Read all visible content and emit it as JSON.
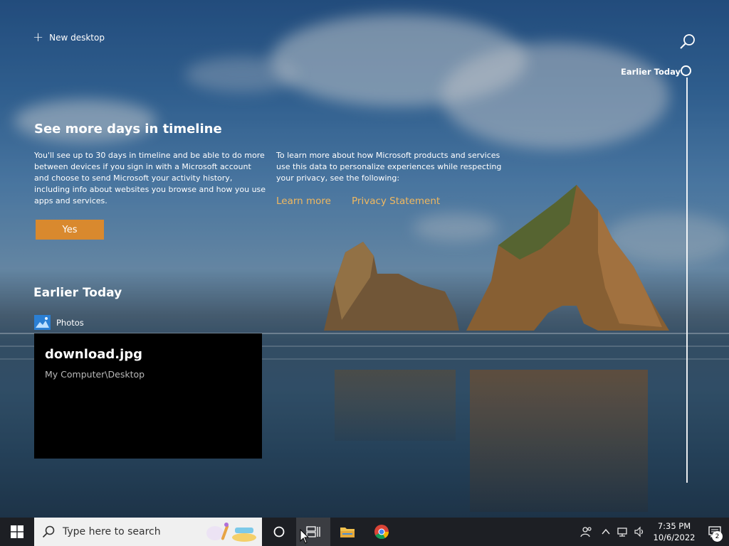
{
  "timeline": {
    "new_desktop_label": "New desktop",
    "promo": {
      "title": "See more days in timeline",
      "left_text": "You'll see up to 30 days in timeline and be able to do more between devices if you sign in with a Microsoft account and choose to send Microsoft your activity history, including info about websites you browse and how you use apps and services.",
      "right_text": "To learn more about how Microsoft products and services use this data to personalize experiences while respecting your privacy, see the following:",
      "learn_more": "Learn more",
      "privacy": "Privacy Statement",
      "yes_label": "Yes"
    },
    "section_title": "Earlier Today",
    "activity": {
      "app_name": "Photos",
      "file_name": "download.jpg",
      "file_path": "My Computer\\Desktop"
    },
    "scrubber_label": "Earlier Today"
  },
  "taskbar": {
    "search_placeholder": "Type here to search",
    "clock_time": "7:35 PM",
    "clock_date": "10/6/2022",
    "notification_count": "2",
    "pinned": [
      "cortana-icon",
      "task-view-icon",
      "file-explorer-icon",
      "chrome-icon"
    ]
  },
  "colors": {
    "accent": "#d9892e",
    "link": "#f0b860",
    "taskbar": "#1d1f24"
  }
}
